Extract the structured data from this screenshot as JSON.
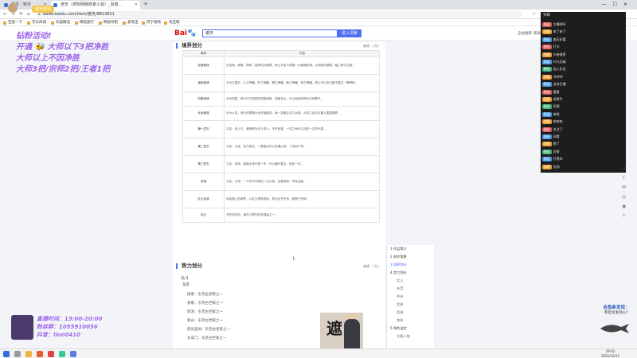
{
  "browser": {
    "tabs": [
      {
        "label": "首页 - 知乎"
      },
      {
        "label": "遮天（搜狗网络修真小说）_百度..."
      }
    ],
    "new_tab": "+",
    "url": "baike.baidu.com/item/遮天/8813811",
    "bookmarks": [
      "百度一下",
      "京东商城",
      "天猫精选",
      "携程旅行",
      "网站导航",
      "爱淘宝",
      "苏宁易购",
      "淘宝网"
    ]
  },
  "baidu": {
    "logo_b": "Bai",
    "logo_du": "百科",
    "search_value": "遮天",
    "search_button": "进入词条",
    "header_links": [
      "全站搜索",
      "帮助"
    ]
  },
  "overlay": {
    "streamer_name": "遮天虎哥",
    "lines": [
      "钻粉活动!",
      "开通 🐝 大师以下3把净胜",
      "大师以上不因净胜",
      "大师3把/宗师2把/王者1把"
    ]
  },
  "article": {
    "section1_title": "境界划分",
    "section_tools": [
      "编辑",
      "讨论"
    ],
    "table_headers": [
      "境界",
      "介绍"
    ],
    "table_rows": [
      {
        "name": "轮海秘境",
        "desc": "分苦海、命泉、神桥、彼岸四大境界。修士开启人体第一大秘境轮海，以肉身为根基，踏上修行之路。"
      },
      {
        "name": "道宫秘境",
        "desc": "分为五重天，心之神藏、肝之神藏、脾之神藏、肺之神藏、肾之神藏，修士可以在五脏中各生一尊神祇。"
      },
      {
        "name": "四极秘境",
        "desc": "分为四层，修士打开四肢的四极秘境，四极壮大，可以用血肉炼化天地精气。"
      },
      {
        "name": "化龙秘境",
        "desc": "分为九变，修士的脊椎大龙开始蜕变，每一变都让实力大增，九变之后可以踏入更高境界。"
      },
      {
        "name": "第一层天",
        "desc": "又名：圣人王，被尊称为圣人的人，不可轻视，一念之间可以决定一方的兴衰。"
      },
      {
        "name": "第二层天",
        "desc": "又名：大圣，实力强大，一根发丝可以压塌山河，人世间少有。"
      },
      {
        "name": "第三层天",
        "desc": "又名：准帝，距离大帝只差一步，可以横行星空，镇压一切。"
      },
      {
        "name": "帝境",
        "desc": "又名：大帝，一个时代只能出一位大帝，证道成帝，举世无敌。"
      },
      {
        "name": "红尘仙境",
        "desc": "成仙路上的境界，以红尘修炼成仙，寿元近乎无尽，超脱于世间。"
      },
      {
        "name": "仙王",
        "desc": "不朽的存在，诸天万界中的至强者之一。"
      }
    ],
    "section2_title": "势力划分",
    "section2_sub": "北斗",
    "section2_sub2": "东荒",
    "forces": [
      "姬家：东荒古世家之一",
      "姜家：东荒古世家之一",
      "瑶池：东荒古世家之一",
      "紫山：东荒古世家之一",
      "摇光圣地：东荒古世家之一",
      "太玄门：东荒古世家之一"
    ],
    "figure_char": "遮"
  },
  "toc": {
    "items": [
      {
        "label": "1  作品简介",
        "sub": false,
        "current": false
      },
      {
        "label": "2  创作背景",
        "sub": false,
        "current": false
      },
      {
        "label": "3  境界划分",
        "sub": false,
        "current": true
      },
      {
        "label": "4  势力划分",
        "sub": false,
        "current": false
      },
      {
        "label": "北斗",
        "sub": true,
        "current": false
      },
      {
        "label": "东荒",
        "sub": true,
        "current": false
      },
      {
        "label": "中州",
        "sub": true,
        "current": false
      },
      {
        "label": "北原",
        "sub": true,
        "current": false
      },
      {
        "label": "西漠",
        "sub": true,
        "current": false
      },
      {
        "label": "南岭",
        "sub": true,
        "current": false
      },
      {
        "label": "5  角色设定",
        "sub": false,
        "current": false
      },
      {
        "label": "主要人物",
        "sub": true,
        "current": false
      }
    ]
  },
  "chat": {
    "header": "弹幕",
    "rows": [
      {
        "badge": "粉丝",
        "color": "#e05b5b",
        "msg": "主播666"
      },
      {
        "badge": "钻粉",
        "color": "#f0a030",
        "msg": "来了来了"
      },
      {
        "badge": "粉丝",
        "color": "#4c9be8",
        "msg": "遮天好看"
      },
      {
        "badge": "粉丝",
        "color": "#e05b5b",
        "msg": "打卡"
      },
      {
        "badge": "钻粉",
        "color": "#f0a030",
        "msg": "大帝境界"
      },
      {
        "badge": "粉丝",
        "color": "#4c9be8",
        "msg": "叶凡无敌"
      },
      {
        "badge": "粉丝",
        "color": "#3fb57a",
        "msg": "加入队伍"
      },
      {
        "badge": "钻粉",
        "color": "#f0a030",
        "msg": "冲冲冲"
      },
      {
        "badge": "粉丝",
        "color": "#4c9be8",
        "msg": "支持主播"
      },
      {
        "badge": "粉丝",
        "color": "#e05b5b",
        "msg": "看看"
      },
      {
        "badge": "钻粉",
        "color": "#f0a030",
        "msg": "虎哥牛"
      },
      {
        "badge": "粉丝",
        "color": "#3fb57a",
        "msg": "好耶"
      },
      {
        "badge": "粉丝",
        "color": "#4c9be8",
        "msg": "来啦"
      },
      {
        "badge": "钻粉",
        "color": "#f0a030",
        "msg": "哈哈哈"
      },
      {
        "badge": "粉丝",
        "color": "#e05b5b",
        "msg": "关注了"
      },
      {
        "badge": "粉丝",
        "color": "#4c9be8",
        "msg": "好看"
      },
      {
        "badge": "钻粉",
        "color": "#f0a030",
        "msg": "稳了"
      },
      {
        "badge": "粉丝",
        "color": "#3fb57a",
        "msg": "厉害"
      },
      {
        "badge": "粉丝",
        "color": "#4c9be8",
        "msg": "开黑吗"
      },
      {
        "badge": "钻粉",
        "color": "#f0a030",
        "msg": "加油"
      }
    ]
  },
  "stream_card": {
    "line1": "直播时间：13:00-20:00",
    "line2": "粉丝群：1055910056",
    "line3": "抖音：lion0410"
  },
  "promo": {
    "title": "吉鱼新发现：",
    "subtitle": "和恐龙发现火?"
  },
  "clock": {
    "time": "19:02",
    "date": "2021/10/12"
  },
  "colors": {
    "accent": "#4e6ef2",
    "overlay_purple": "#9a63e8"
  }
}
